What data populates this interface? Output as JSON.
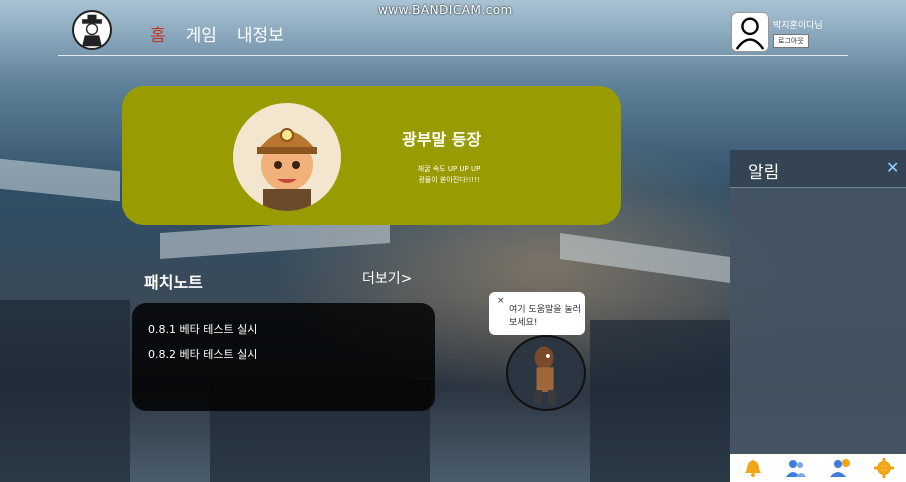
{
  "watermark": "www.BANDICAM.com",
  "header": {
    "nav": {
      "home": "홈",
      "game": "게임",
      "profile": "내정보"
    },
    "username": "박지훈이다님",
    "logout": "로그아웃"
  },
  "banner": {
    "title": "광부말 등장",
    "desc_line1": "채굴 속도 UP UP UP",
    "desc_line2": "광물이 쏟아진다!!!!!"
  },
  "patch": {
    "title": "패치노트",
    "more": "더보기>",
    "items": [
      "0.8.1 베타 테스트 실시",
      "0.8.2 베타 테스트 실시"
    ]
  },
  "bubble": {
    "close": "×",
    "text": "여기 도움말을 눌러보세요!"
  },
  "notice": {
    "title": "알림",
    "close": "✕",
    "footer_icons": [
      "bell-icon",
      "users-icon",
      "user-add-icon",
      "gear-icon"
    ]
  },
  "colors": {
    "banner": "#999c00",
    "home_active": "#c0392b",
    "gear": "#f2a516",
    "bell": "#f2a516",
    "users": "#3b7dd8"
  }
}
